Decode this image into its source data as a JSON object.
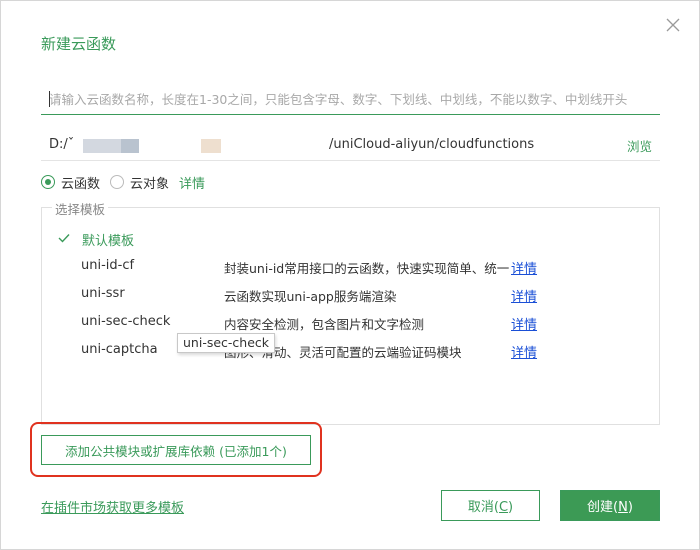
{
  "dialog": {
    "title": "新建云函数",
    "close_icon": "close-icon"
  },
  "name_input": {
    "value": "",
    "placeholder": "请输入云函数名称，长度在1-30之间，只能包含字母、数字、下划线、中划线，不能以数字、中划线开头"
  },
  "path": {
    "prefix": "D:/ˇ",
    "suffix": "/uniCloud-aliyun/cloudfunctions",
    "browse_label": "浏览"
  },
  "type_options": {
    "cloud_function_label": "云函数",
    "cloud_object_label": "云对象",
    "selected": "云函数",
    "detail_label": "详情"
  },
  "templates": {
    "legend": "选择模板",
    "default_label": "默认模板",
    "items": [
      {
        "name": "uni-id-cf",
        "desc": "封装uni-id常用接口的云函数，快速实现简单、统一、",
        "detail": "详情"
      },
      {
        "name": "uni-ssr",
        "desc": "云函数实现uni-app服务端渲染",
        "detail": "详情"
      },
      {
        "name": "uni-sec-check",
        "desc": "内容安全检测，包含图片和文字检测",
        "detail": "详情"
      },
      {
        "name": "uni-captcha",
        "desc": "图形、滑动、灵活可配置的云端验证码模块",
        "detail": "详情"
      }
    ]
  },
  "tooltip": {
    "text": "uni-sec-check"
  },
  "add_deps_button": {
    "label": "添加公共模块或扩展库依赖 (已添加1个)"
  },
  "market_link": {
    "label": "在插件市场获取更多模板"
  },
  "footer": {
    "cancel_label": "取消(",
    "cancel_key": "C",
    "cancel_close": ")",
    "create_label": "创建(",
    "create_key": "N",
    "create_close": ")"
  },
  "colors": {
    "accent": "#3a9a5a",
    "link_blue": "#1a4fd6",
    "highlight_red": "#e0321f"
  }
}
